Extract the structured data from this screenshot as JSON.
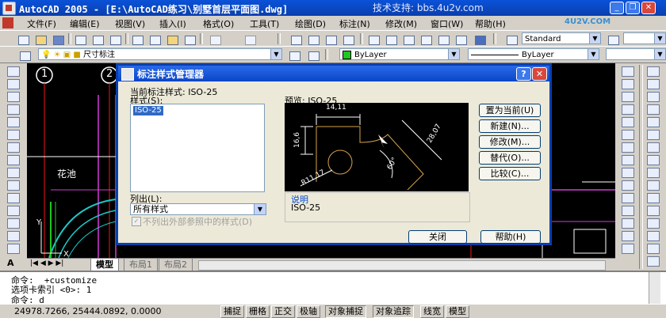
{
  "window": {
    "title": "AutoCAD 2005 - [E:\\AutoCAD练习\\别墅首层平面图.dwg]",
    "watermark": "技术支持: bbs.4u2v.com",
    "logo_text": "4U2V.COM"
  },
  "menu": [
    "文件(F)",
    "编辑(E)",
    "视图(V)",
    "插入(I)",
    "格式(O)",
    "工具(T)",
    "绘图(D)",
    "标注(N)",
    "修改(M)",
    "窗口(W)",
    "帮助(H)"
  ],
  "toolbar": {
    "text_style": "Standard",
    "current_layer": "尺寸标注",
    "color": "ByLayer",
    "linetype": "ByLayer"
  },
  "drawing": {
    "grid_labels": [
      "1",
      "2"
    ],
    "room_label": "花池",
    "ucs_x": "X",
    "ucs_y": "Y"
  },
  "layout_tabs": [
    "模型",
    "布局1",
    "布局2"
  ],
  "command": {
    "line1": "命令: _+customize",
    "line2": "选项卡索引 <0>: 1",
    "line3": "命令: d"
  },
  "status": {
    "coords": "24978.7266, 25444.0892, 0.0000",
    "buttons": [
      "捕捉",
      "栅格",
      "正交",
      "极轴",
      "对象捕捉",
      "对象追踪",
      "线宽",
      "模型"
    ]
  },
  "dialog": {
    "title": "标注样式管理器",
    "current_style_label": "当前标注样式: ISO-25",
    "styles_label": "样式(S):",
    "styles": [
      "ISO-25"
    ],
    "list_label": "列出(L):",
    "list_value": "所有样式",
    "exclude_xref_label": "不列出外部参照中的样式(D)",
    "preview_label": "预览: ISO-25",
    "description_label": "说明",
    "description_value": "ISO-25",
    "buttons": {
      "set_current": "置为当前(U)",
      "new": "新建(N)...",
      "modify": "修改(M)...",
      "override": "替代(O)...",
      "compare": "比较(C)...",
      "close": "关闭",
      "help": "帮助(H)"
    },
    "preview_dims": [
      "14,11",
      "16,6",
      "28,07",
      "60°",
      "R11,17"
    ]
  },
  "colors": {
    "title_blue": "#0a46c8",
    "canvas": "#000000",
    "dim_line": "#d6a34a"
  }
}
